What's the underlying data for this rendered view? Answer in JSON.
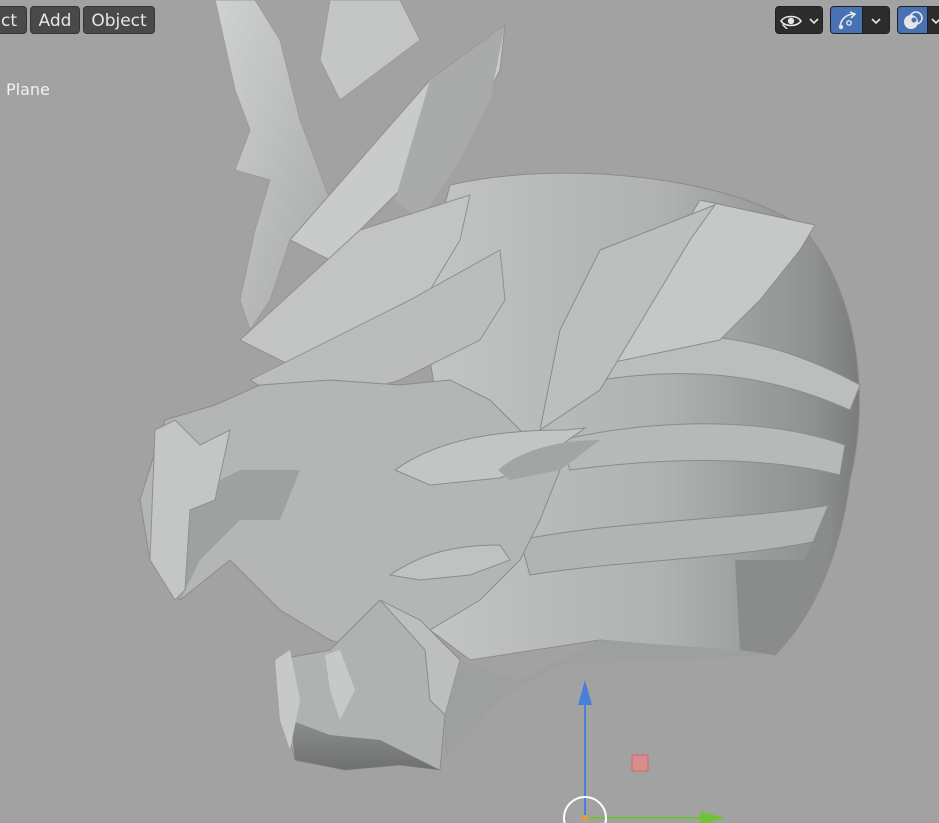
{
  "header": {
    "menu": [
      {
        "id": "select",
        "label": "ect"
      },
      {
        "id": "add",
        "label": "Add"
      },
      {
        "id": "object",
        "label": "Object"
      }
    ],
    "icons": {
      "visibility": "eye-icon",
      "visibility_dropdown": "chevron-down-icon",
      "gizmo": "gizmo-arrow-icon",
      "gizmo_dropdown": "chevron-down-icon",
      "overlay": "overlay-circles-icon"
    }
  },
  "viewport": {
    "object_label": "Plane",
    "background_color": "#a2a2a2",
    "model_color": "#b7b9b9",
    "gizmo_axes": {
      "z_color": "#4a7fd6",
      "y_color": "#6fc23a",
      "x_handle_color": "#d98d8d"
    }
  }
}
